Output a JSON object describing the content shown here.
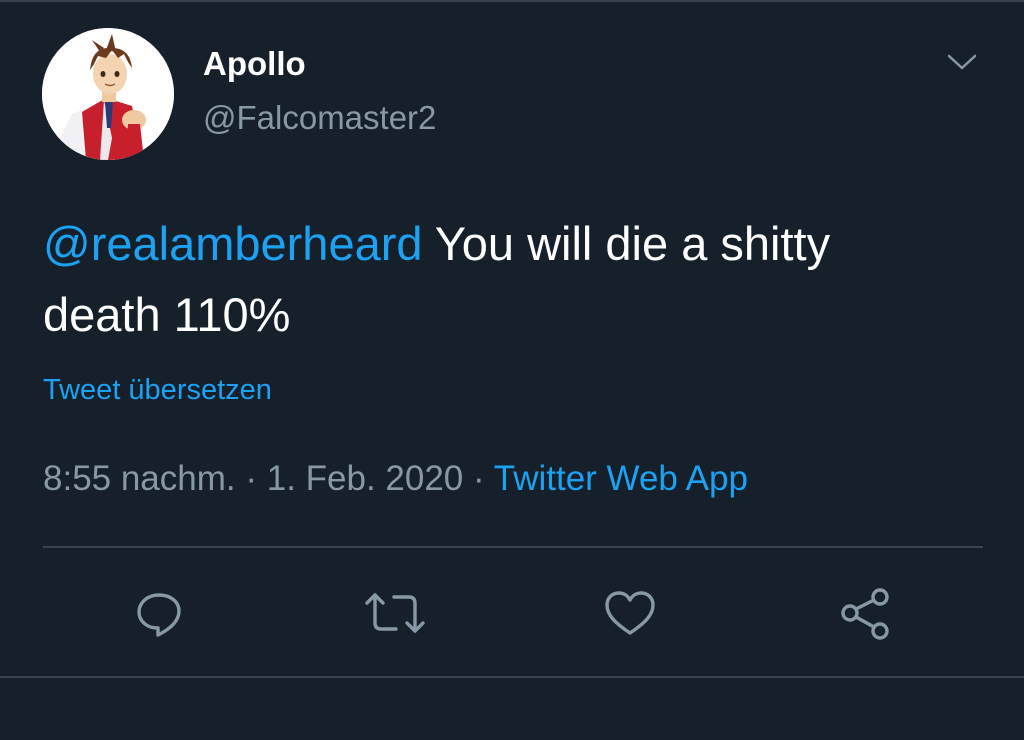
{
  "tweet": {
    "author": {
      "display_name": "Apollo",
      "handle": "@Falcomaster2",
      "avatar_icon": "anime-lawyer-avatar"
    },
    "text": {
      "mention": "@realamberheard",
      "body": " You will die a shitty death 110%"
    },
    "translate_label": "Tweet übersetzen",
    "timestamp": "8:55 nachm. · 1. Feb. 2020",
    "separator": " · ",
    "source": "Twitter Web App",
    "actions": {
      "reply_icon": "reply-icon",
      "retweet_icon": "retweet-icon",
      "like_icon": "heart-icon",
      "share_icon": "share-icon"
    }
  },
  "colors": {
    "background": "#15202b",
    "accent": "#1da1f2",
    "secondary_text": "#8899a6",
    "border": "#38444d"
  }
}
